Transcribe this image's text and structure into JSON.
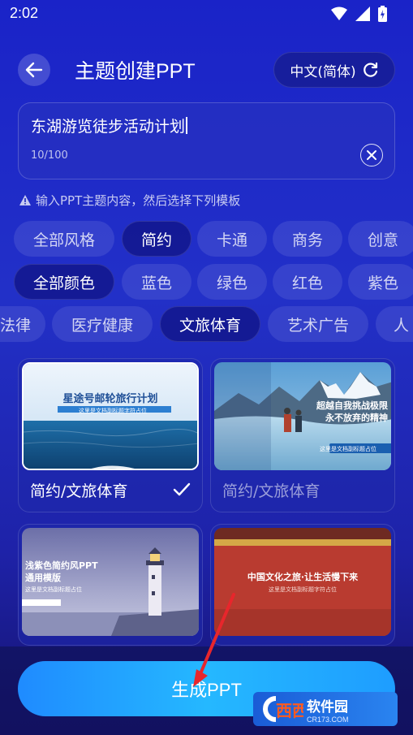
{
  "status_bar": {
    "time": "2:02"
  },
  "header": {
    "title": "主题创建PPT",
    "language_label": "中文(简体)"
  },
  "input": {
    "value": "东湖游览徒步活动计划",
    "char_count": "10/100"
  },
  "hint": "输入PPT主题内容，然后选择下列模板",
  "style_chips": [
    {
      "label": "全部风格",
      "active": false
    },
    {
      "label": "简约",
      "active": true
    },
    {
      "label": "卡通",
      "active": false
    },
    {
      "label": "商务",
      "active": false
    },
    {
      "label": "创意",
      "active": false
    }
  ],
  "color_chips": [
    {
      "label": "全部颜色",
      "active": true
    },
    {
      "label": "蓝色",
      "active": false
    },
    {
      "label": "绿色",
      "active": false
    },
    {
      "label": "红色",
      "active": false
    },
    {
      "label": "紫色",
      "active": false
    }
  ],
  "category_chips": [
    {
      "label": "法律",
      "active": false
    },
    {
      "label": "医疗健康",
      "active": false
    },
    {
      "label": "文旅体育",
      "active": true
    },
    {
      "label": "艺术广告",
      "active": false
    },
    {
      "label": "人",
      "active": false
    }
  ],
  "templates": [
    {
      "label": "简约/文旅体育",
      "selected": true,
      "thumb_title": "星途号邮轮旅行计划",
      "thumb_sub": "这里是文档副标题字符占位"
    },
    {
      "label": "简约/文旅体育",
      "selected": false,
      "thumb_title_line1": "超越自我挑战极限",
      "thumb_title_line2": "永不放弃的精神",
      "thumb_sub": "这里是文档副标题占位"
    },
    {
      "label": "",
      "selected": false,
      "thumb_title_line1": "浅紫色简约风PPT",
      "thumb_title_line2": "通用模版",
      "thumb_sub": "这里是文档副标题占位"
    },
    {
      "label": "",
      "selected": false,
      "thumb_title": "中国文化之旅·让生活慢下来",
      "thumb_sub": "这里是文档副标题字符占位"
    }
  ],
  "generate_button": {
    "label": "生成PPT"
  },
  "watermark": {
    "main": "软件园",
    "url": "CR173.COM"
  },
  "colors": {
    "accent": "#1f8bff",
    "background": "#1a23c8"
  }
}
